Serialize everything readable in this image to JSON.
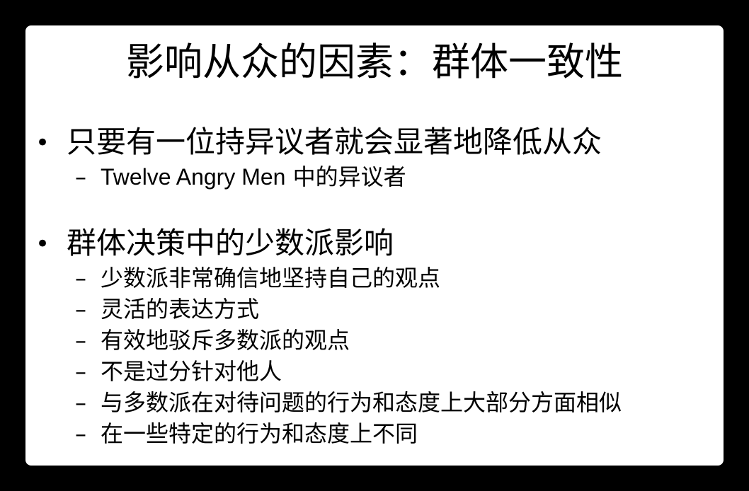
{
  "slide": {
    "title": "影响从众的因素：群体一致性",
    "bullet_symbol": "•",
    "dash_symbol": "–",
    "sections": [
      {
        "bullet": "只要有一位持异议者就会显著地降低从众",
        "subitems": [
          {
            "latin": "Twelve Angry Men",
            "text": " 中的异议者"
          }
        ]
      },
      {
        "bullet": "群体决策中的少数派影响",
        "subitems": [
          "少数派非常确信地坚持自己的观点",
          "灵活的表达方式",
          "有效地驳斥多数派的观点",
          "不是过分针对他人",
          "与多数派在对待问题的行为和态度上大部分方面相似",
          "在一些特定的行为和态度上不同"
        ]
      }
    ]
  }
}
